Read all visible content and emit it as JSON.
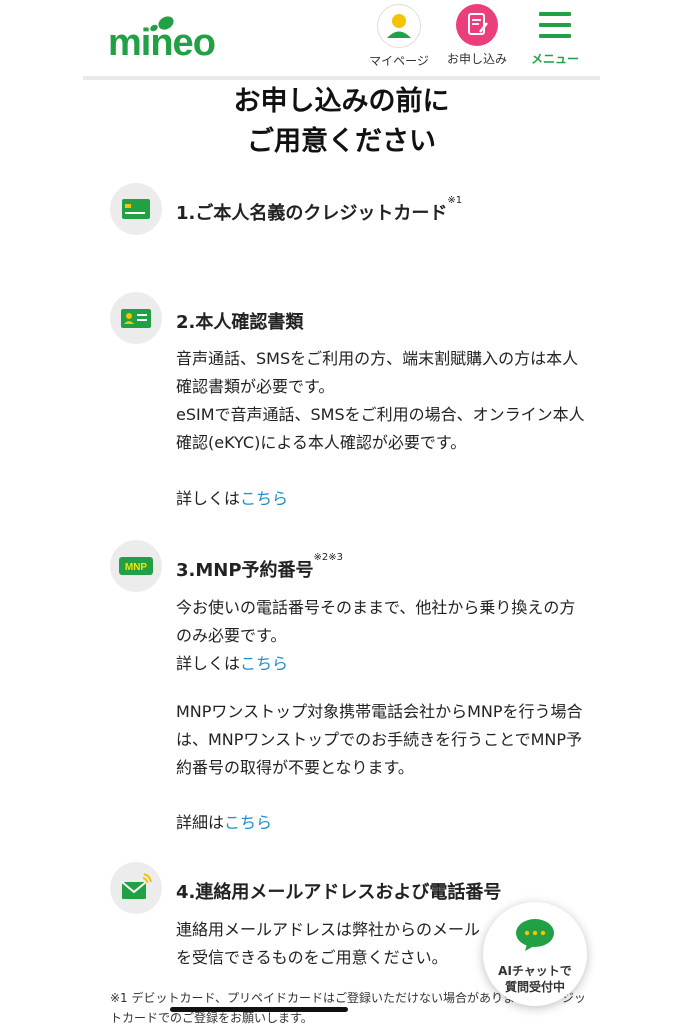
{
  "header": {
    "logo": "mineo",
    "mypage_label": "マイページ",
    "apply_label": "お申し込み",
    "menu_label": "メニュー"
  },
  "title": {
    "line1": "お申し込みの前に",
    "line2": "ご用意ください"
  },
  "sections": [
    {
      "icon": "credit-card-icon",
      "title": "1.ご本人名義のクレジットカード",
      "note": "※1"
    },
    {
      "icon": "id-card-icon",
      "title": "2.本人確認書類",
      "paragraphs": [
        "音声通話、SMSをご利用の方、端末割賦購入の方は本人確認書類が必要です。",
        "eSIMで音声通話、SMSをご利用の場合、オンライン本人確認(eKYC)による本人確認が必要です。"
      ],
      "more_prefix": "詳しくは",
      "more_link": "こちら"
    },
    {
      "icon": "mnp-icon",
      "icon_text": "MNP",
      "title": "3.MNP予約番号",
      "note": "※2※3",
      "paragraphs": [
        "今お使いの電話番号そのままで、他社から乗り換えの方のみ必要です。"
      ],
      "more_prefix": "詳しくは",
      "more_link": "こちら",
      "paragraph2": "MNPワンストップ対象携帯電話会社からMNPを行う場合は、MNPワンストップでのお手続きを行うことでMNP予約番号の取得が不要となります。",
      "detail_prefix": "詳細は",
      "detail_link": "こちら"
    },
    {
      "icon": "mail-phone-icon",
      "title": "4.連絡用メールアドレスおよび電話番号",
      "paragraphs": [
        "連絡用メールアドレスは弊社からのメールを受信できるものをご用意ください。"
      ]
    }
  ],
  "footnote": "※1 デビットカード、プリペイドカードはご登録いただけない場合があります。クレジットカードでのご登録をお願いします。",
  "chat": {
    "line1": "AIチャットで",
    "line2": "質問受付中"
  },
  "colors": {
    "brand_green": "#22a045",
    "apply_pink": "#ea3f7c",
    "link_blue": "#1f8ec9",
    "icon_bg": "#ececec"
  }
}
